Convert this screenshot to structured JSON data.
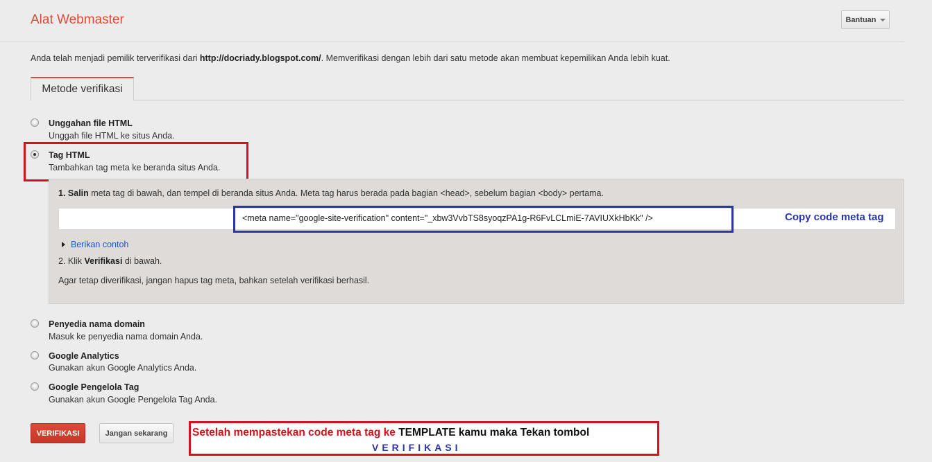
{
  "header": {
    "app_title": "Alat Webmaster",
    "help_label": "Bantuan"
  },
  "notice": {
    "prefix": "Anda telah menjadi pemilik terverifikasi dari ",
    "site": "http://docriady.blogspot.com/",
    "suffix": ". Memverifikasi dengan lebih dari satu metode akan membuat kepemilikan Anda lebih kuat."
  },
  "tabs": [
    {
      "label": "Metode verifikasi",
      "active": true
    }
  ],
  "methods": [
    {
      "title": "Unggahan file HTML",
      "desc": "Unggah file HTML ke situs Anda.",
      "selected": false
    },
    {
      "title": "Tag HTML",
      "desc": "Tambahkan tag meta ke beranda situs Anda.",
      "selected": true
    },
    {
      "title": "Penyedia nama domain",
      "desc": "Masuk ke penyedia nama domain Anda.",
      "selected": false
    },
    {
      "title": "Google Analytics",
      "desc": "Gunakan akun Google Analytics Anda.",
      "selected": false
    },
    {
      "title": "Google Pengelola Tag",
      "desc": "Gunakan akun Google Pengelola Tag Anda.",
      "selected": false
    }
  ],
  "instructions": {
    "step1_num": "1.",
    "step1_bold": "Salin",
    "step1_rest": " meta tag di bawah, dan tempel di beranda situs Anda. Meta tag harus berada pada bagian <head>, sebelum bagian <body> pertama.",
    "meta_tag": "<meta name=\"google-site-verification\" content=\"_xbw3VvbTS8syoqzPA1g-R6FvLCLmiE-7AVIUXkHbKk\" />",
    "example_link": "Berikan contoh",
    "step2_prefix": "2. Klik ",
    "step2_bold": "Verifikasi",
    "step2_suffix": " di bawah.",
    "note": "Agar tetap diverifikasi, jangan hapus tag meta, bahkan setelah verifikasi berhasil."
  },
  "actions": {
    "verify_label": "VERIFIKASI",
    "later_label": "Jangan sekarang"
  },
  "annotations": {
    "copy_meta": "Copy code meta tag",
    "bottom_red": "Setelah mempastekan code meta tag ke ",
    "bottom_black": "TEMPLATE kamu maka Tekan tombol",
    "bottom_blue": "VERIFIKASI"
  },
  "colors": {
    "brand_red": "#dd4b39",
    "annotation_red": "#d4121b",
    "annotation_blue": "#2b35a8",
    "link_blue": "#1a56c9"
  }
}
